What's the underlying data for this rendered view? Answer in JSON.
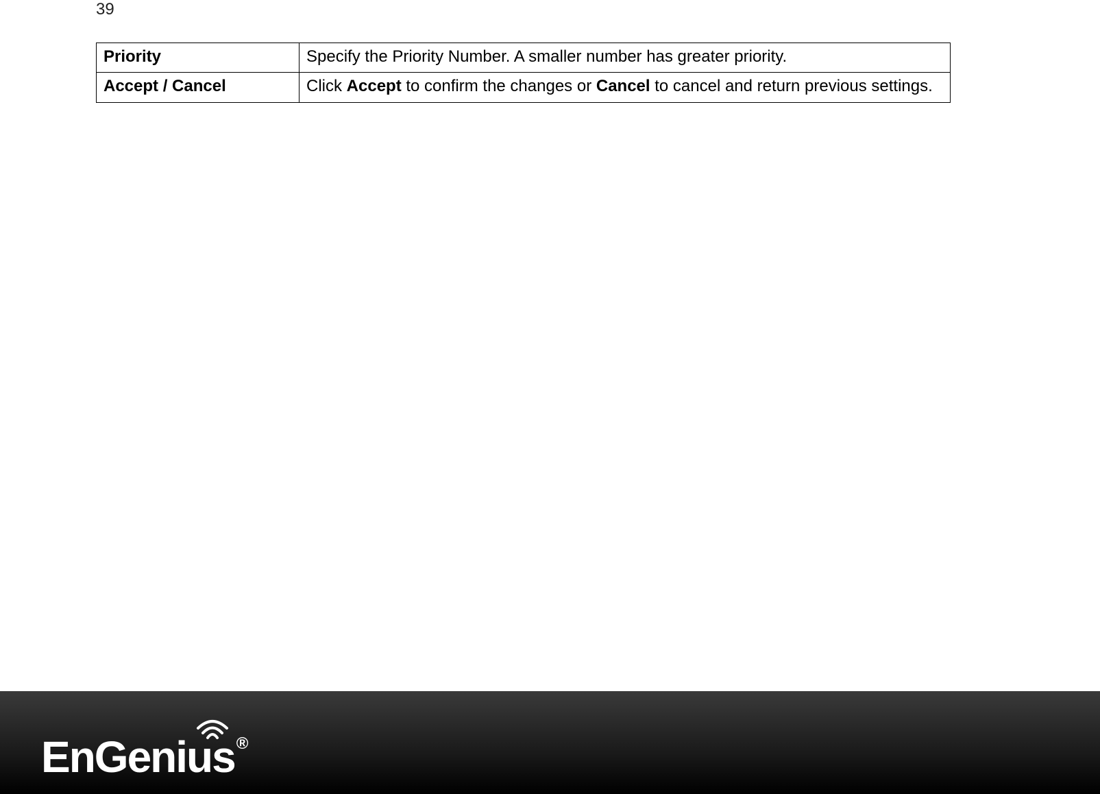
{
  "page_number": "39",
  "table": {
    "rows": [
      {
        "label": "Priority",
        "desc_plain": "Specify the Priority Number. A smaller number has greater priority."
      },
      {
        "label": "Accept / Cancel",
        "desc_pre": "Click ",
        "desc_b1": "Accept",
        "desc_mid": " to confirm the changes or ",
        "desc_b2": "Cancel",
        "desc_post": " to cancel and return previous settings."
      }
    ]
  },
  "logo": {
    "text": "EnGenius",
    "registered": "®"
  }
}
